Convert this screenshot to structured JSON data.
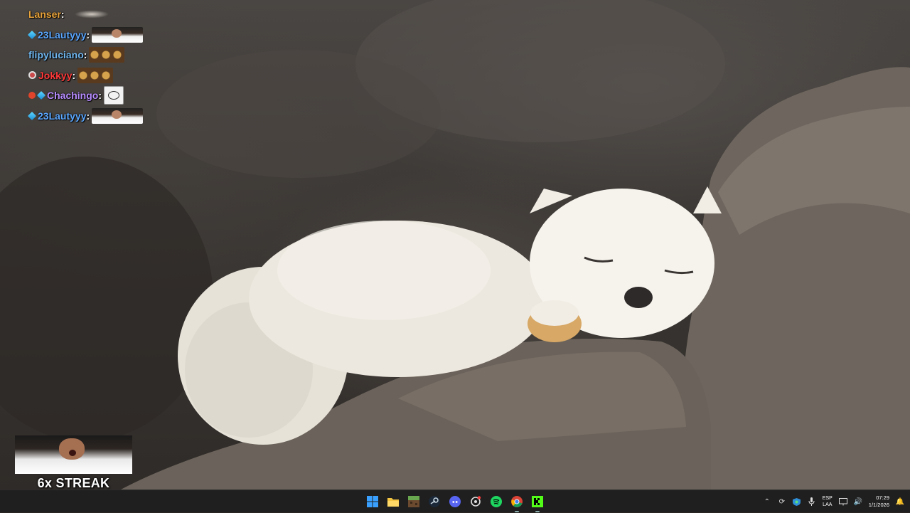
{
  "desktop": {
    "wallpaper": "Sleeping arctic fox on rocks"
  },
  "chat": {
    "messages": [
      {
        "user": "Lanser",
        "color": "#e8a33a",
        "badges": [],
        "emote": "plane-emote"
      },
      {
        "user": "23Lautyyy",
        "color": "#5aa7ff",
        "badges": [
          "cube-badge"
        ],
        "emote": "man-emote"
      },
      {
        "user": "flipyluciano",
        "color": "#6fb7f0",
        "badges": [],
        "emote": "trio-emote"
      },
      {
        "user": "Jokkyy",
        "color": "#ff3a3a",
        "badges": [
          "ring-badge"
        ],
        "emote": "trio-emote"
      },
      {
        "user": "Chachingo",
        "color": "#b78cff",
        "badges": [
          "red-badge",
          "cube-badge"
        ],
        "emote": "sketch-emote"
      },
      {
        "user": "23Lautyyy",
        "color": "#5aa7ff",
        "badges": [
          "cube-badge"
        ],
        "emote": "man-emote"
      }
    ],
    "separator": ":"
  },
  "streak": {
    "label": "6x STREAK"
  },
  "taskbar": {
    "apps": [
      {
        "name": "windows-start-icon",
        "color": "#2fa4ff"
      },
      {
        "name": "file-explorer-icon",
        "color": "#f4c542"
      },
      {
        "name": "minecraft-icon",
        "color": "#6aa84f"
      },
      {
        "name": "steam-icon",
        "color": "#c7d5e0"
      },
      {
        "name": "discord-icon",
        "color": "#5865f2"
      },
      {
        "name": "chatgpt-icon",
        "color": "#e0e0e0"
      },
      {
        "name": "spotify-icon",
        "color": "#1ed760"
      },
      {
        "name": "chrome-icon",
        "color": "#db4437"
      },
      {
        "name": "kick-icon",
        "color": "#53fc18"
      }
    ],
    "tray": {
      "lang_top": "ESP",
      "lang_bottom": "LAA",
      "time": "07:29",
      "date": "1/1/2026"
    }
  }
}
